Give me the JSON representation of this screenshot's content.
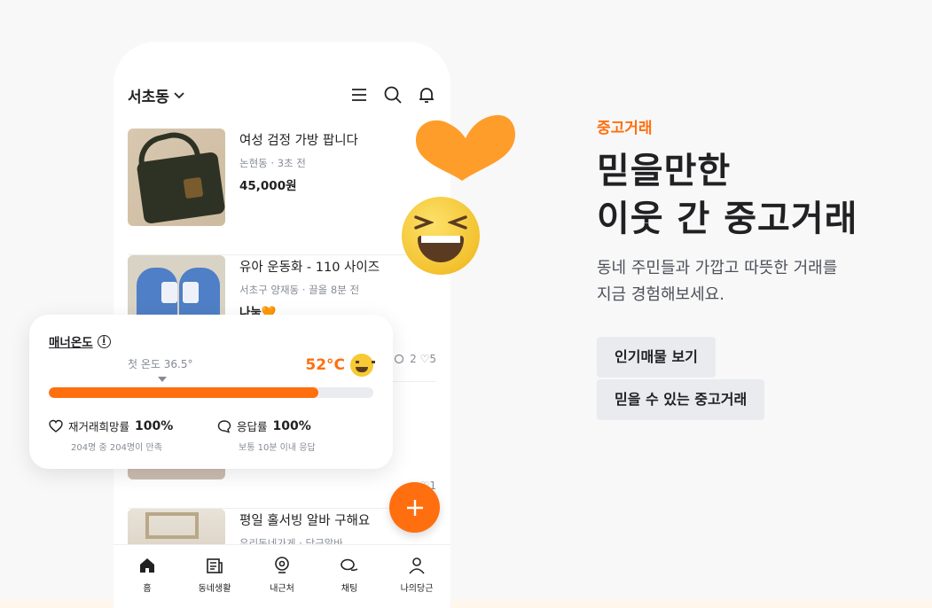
{
  "header": {
    "location": "서초동"
  },
  "listings": [
    {
      "title": "여성 검정 가방 팝니다",
      "meta": "논현동 · 3초 전",
      "price": "45,000원",
      "stats": ""
    },
    {
      "title": "유아 운동화 - 110 사이즈",
      "meta": "서초구 양재동 · 끌올 8분 전",
      "price": "나눔🧡",
      "stats": "2  ♡5"
    },
    {
      "title": "",
      "meta": "",
      "price": "",
      "stats": "♡1"
    },
    {
      "title": "평일 홀서빙 알바 구해요",
      "meta": "우리동네가게 · 당근알바",
      "price": "",
      "stats": ""
    }
  ],
  "tabbar": {
    "items": [
      {
        "label": "홈",
        "icon": "home-icon"
      },
      {
        "label": "동네생활",
        "icon": "newspaper-icon"
      },
      {
        "label": "내근처",
        "icon": "location-pin-icon"
      },
      {
        "label": "채팅",
        "icon": "chat-bubbles-icon"
      },
      {
        "label": "나의당근",
        "icon": "person-icon"
      }
    ]
  },
  "manner": {
    "title": "매너온도",
    "info_symbol": "i",
    "first_temp": "첫 온도 36.5°",
    "temperature": "52°C",
    "progress": 0.83,
    "rehire_label": "재거래희망률",
    "rehire_value": "100%",
    "rehire_sub": "204명 중 204명이 만족",
    "response_label": "응답률",
    "response_value": "100%",
    "response_sub": "보통 10분 이내 응답"
  },
  "hero": {
    "eyebrow": "중고거래",
    "headline_line1": "믿을만한",
    "headline_line2": "이웃 간 중고거래",
    "desc_line1": "동네 주민들과 가깝고 따뜻한 거래를",
    "desc_line2": "지금 경험해보세요.",
    "button1": "인기매물 보기",
    "button2": "믿을 수 있는 중고거래"
  },
  "colors": {
    "brand": "#ff6f0f",
    "heart": "#ff9d2a",
    "button_bg": "#eaebee"
  }
}
